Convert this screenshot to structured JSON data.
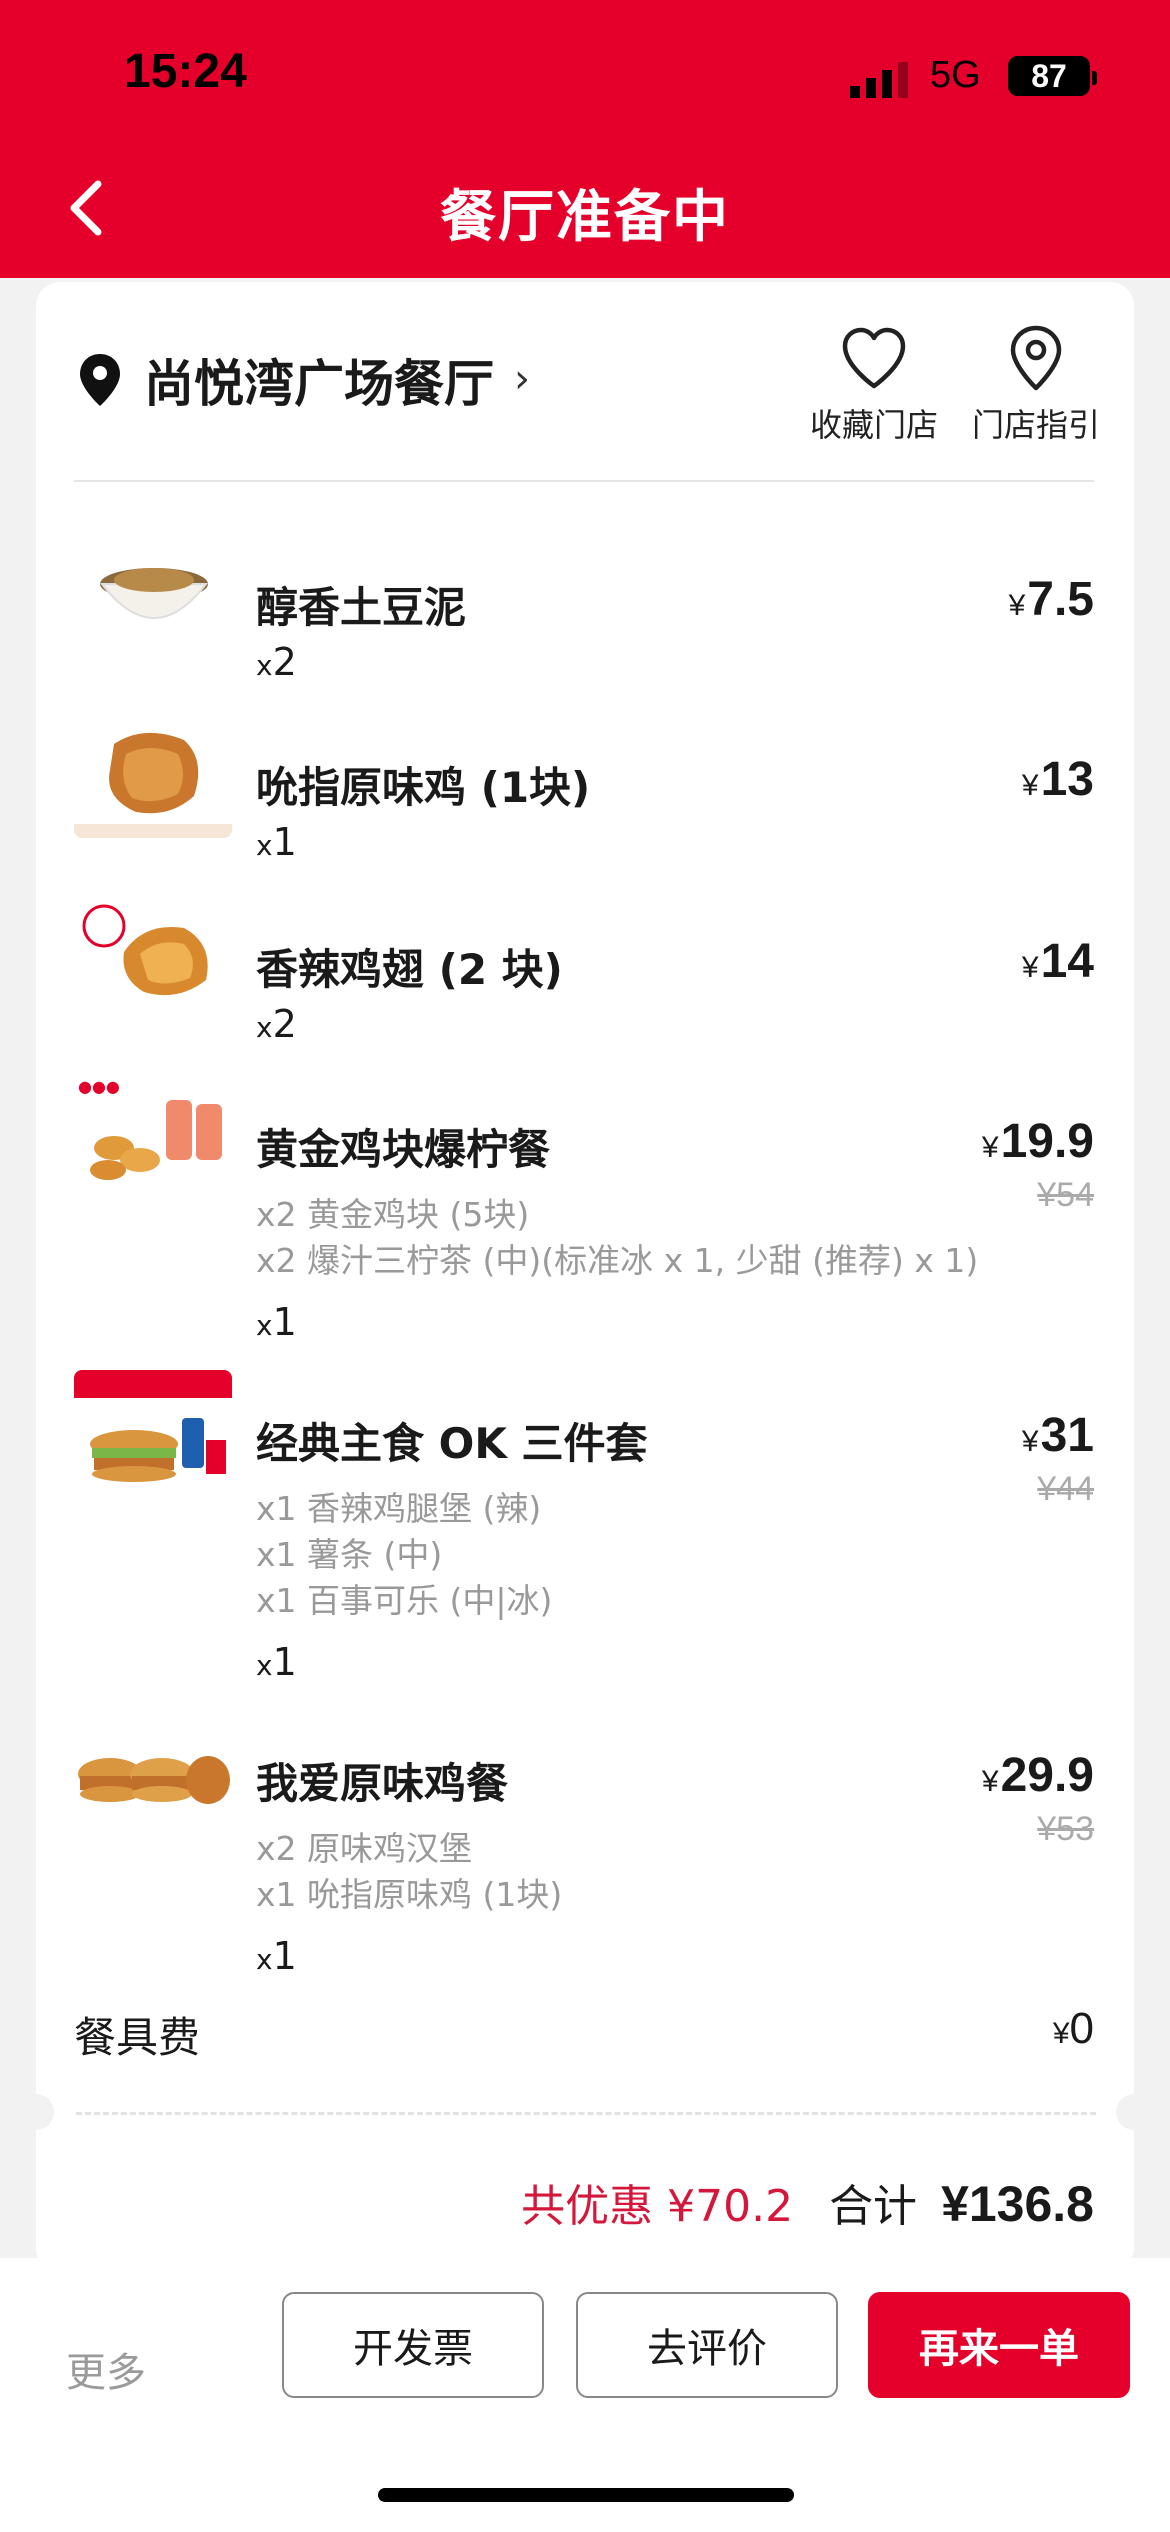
{
  "status": {
    "time": "15:24",
    "network": "5G",
    "battery": "87"
  },
  "header": {
    "title": "餐厅准备中"
  },
  "store": {
    "name": "尚悦湾广场餐厅",
    "chevron": "›",
    "favorite_label": "收藏门店",
    "guide_label": "门店指引"
  },
  "currency": "¥",
  "qty_prefix": "x",
  "items": [
    {
      "name": "醇香土豆泥",
      "qty": "2",
      "price": "7.5",
      "original": "",
      "subs": []
    },
    {
      "name": "吮指原味鸡 (1块)",
      "qty": "1",
      "price": "13",
      "original": "",
      "subs": []
    },
    {
      "name": "香辣鸡翅 (2 块)",
      "qty": "2",
      "price": "14",
      "original": "",
      "subs": []
    },
    {
      "name": "黄金鸡块爆柠餐",
      "qty": "1",
      "price": "19.9",
      "original": "¥54",
      "subs": [
        "x2 黄金鸡块 (5块)",
        "x2 爆汁三柠茶 (中)(标准冰 x 1, 少甜 (推荐) x 1)"
      ]
    },
    {
      "name": "经典主食 OK 三件套",
      "qty": "1",
      "price": "31",
      "original": "¥44",
      "subs": [
        "x1 香辣鸡腿堡 (辣)",
        "x1 薯条 (中)",
        "x1 百事可乐 (中|冰)"
      ]
    },
    {
      "name": "我爱原味鸡餐",
      "qty": "1",
      "price": "29.9",
      "original": "¥53",
      "subs": [
        "x2 原味鸡汉堡",
        "x1 吮指原味鸡 (1块)"
      ]
    }
  ],
  "tableware": {
    "label": "餐具费",
    "price": "0"
  },
  "summary": {
    "discount": "共优惠 ¥70.2",
    "total_label": "合计",
    "total": "¥136.8"
  },
  "bottom": {
    "more": "更多",
    "invoice": "开发票",
    "review": "去评价",
    "reorder": "再来一单"
  },
  "colors": {
    "brand_red": "#e4002b",
    "discount_red": "#d4183b"
  }
}
